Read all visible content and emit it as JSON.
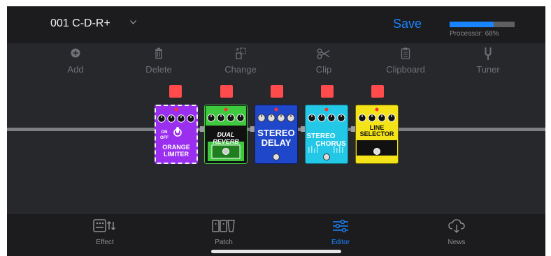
{
  "header": {
    "patch_name": "001 C-D-R+",
    "save_label": "Save",
    "processor_label": "Processor: 68%",
    "processor_percent": 68,
    "accent_color": "#1a84ff"
  },
  "toolbar": {
    "items": [
      {
        "label": "Add",
        "icon": "plus-circle-icon"
      },
      {
        "label": "Delete",
        "icon": "trash-icon"
      },
      {
        "label": "Change",
        "icon": "swap-icon"
      },
      {
        "label": "Clip",
        "icon": "scissors-icon"
      },
      {
        "label": "Clipboard",
        "icon": "clipboard-icon"
      },
      {
        "label": "Tuner",
        "icon": "tuning-fork-icon"
      }
    ]
  },
  "pedals": [
    {
      "name_line1": "ORANGE",
      "name_line2": "LIMITER",
      "color": "#9a2ff0",
      "switch_on": "ON",
      "switch_off": "OFF"
    },
    {
      "name_line1": "DUAL REVERB",
      "name_line2": "",
      "color": "#3ec93e"
    },
    {
      "name_line1": "STEREO",
      "name_line2": "DELAY",
      "color": "#1f47c9"
    },
    {
      "name_line1": "STEREO",
      "name_line2": "CHORUS",
      "color": "#22c8e6"
    },
    {
      "name_line1": "LINE",
      "name_line2": "SELECTOR",
      "color": "#f5e31a"
    }
  ],
  "tabs": [
    {
      "label": "Effect",
      "icon": "effect-icon",
      "active": false
    },
    {
      "label": "Patch",
      "icon": "patch-icon",
      "active": false
    },
    {
      "label": "Editor",
      "icon": "sliders-icon",
      "active": true
    },
    {
      "label": "News",
      "icon": "cloud-download-icon",
      "active": false
    }
  ],
  "selection_color": "#ff4b4b"
}
